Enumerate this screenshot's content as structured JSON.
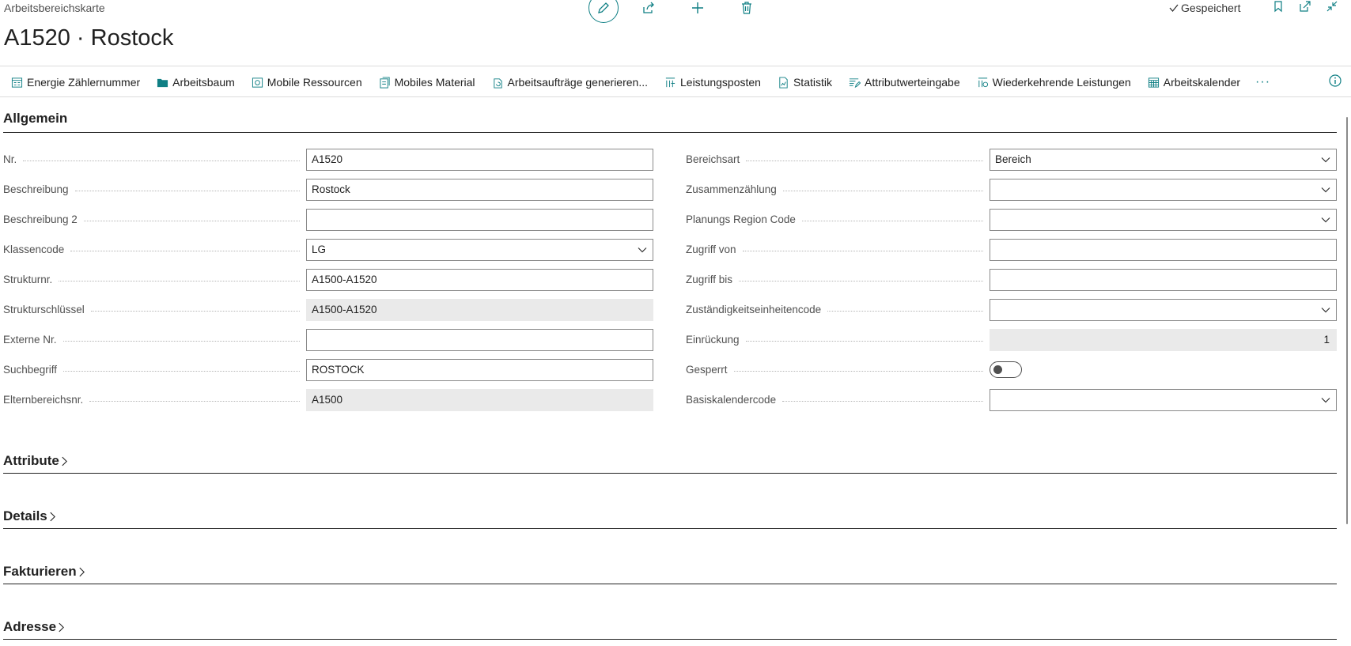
{
  "header": {
    "caption": "Arbeitsbereichskarte",
    "title": "A1520 · Rostock",
    "saved_label": "Gespeichert"
  },
  "actions": [
    {
      "label": "Energie Zählernummer",
      "icon": "meter-icon"
    },
    {
      "label": "Arbeitsbaum",
      "icon": "folder-icon"
    },
    {
      "label": "Mobile Ressourcen",
      "icon": "resources-icon"
    },
    {
      "label": "Mobiles Material",
      "icon": "material-icon"
    },
    {
      "label": "Arbeitsaufträge generieren...",
      "icon": "generate-icon"
    },
    {
      "label": "Leistungsposten",
      "icon": "entries-icon"
    },
    {
      "label": "Statistik",
      "icon": "statistics-icon"
    },
    {
      "label": "Attributwerteingabe",
      "icon": "attribute-icon"
    },
    {
      "label": "Wiederkehrende Leistungen",
      "icon": "recurring-icon"
    },
    {
      "label": "Arbeitskalender",
      "icon": "calendar-icon"
    }
  ],
  "more_label": "···",
  "general": {
    "title": "Allgemein",
    "left": [
      {
        "label": "Nr.",
        "value": "A1520",
        "kind": "text"
      },
      {
        "label": "Beschreibung",
        "value": "Rostock",
        "kind": "text"
      },
      {
        "label": "Beschreibung 2",
        "value": "",
        "kind": "text"
      },
      {
        "label": "Klassencode",
        "value": "LG",
        "kind": "select"
      },
      {
        "label": "Strukturnr.",
        "value": "A1500-A1520",
        "kind": "text"
      },
      {
        "label": "Strukturschlüssel",
        "value": "A1500-A1520",
        "kind": "readonly"
      },
      {
        "label": "Externe Nr.",
        "value": "",
        "kind": "text"
      },
      {
        "label": "Suchbegriff",
        "value": "ROSTOCK",
        "kind": "text"
      },
      {
        "label": "Elternbereichsnr.",
        "value": "A1500",
        "kind": "readonly"
      }
    ],
    "right": [
      {
        "label": "Bereichsart",
        "value": "Bereich",
        "kind": "select"
      },
      {
        "label": "Zusammenzählung",
        "value": "",
        "kind": "select"
      },
      {
        "label": "Planungs Region Code",
        "value": "",
        "kind": "select"
      },
      {
        "label": "Zugriff von",
        "value": "",
        "kind": "text"
      },
      {
        "label": "Zugriff bis",
        "value": "",
        "kind": "text"
      },
      {
        "label": "Zuständigkeitseinheitencode",
        "value": "",
        "kind": "select"
      },
      {
        "label": "Einrückung",
        "value": "1",
        "kind": "readonly-num"
      },
      {
        "label": "Gesperrt",
        "value": "off",
        "kind": "toggle"
      },
      {
        "label": "Basiskalendercode",
        "value": "",
        "kind": "select"
      }
    ]
  },
  "sections": [
    {
      "title": "Attribute"
    },
    {
      "title": "Details"
    },
    {
      "title": "Fakturieren"
    },
    {
      "title": "Adresse"
    }
  ],
  "colors": {
    "accent": "#0f7f84",
    "text": "#212121",
    "readonly_bg": "#eaeaea"
  }
}
